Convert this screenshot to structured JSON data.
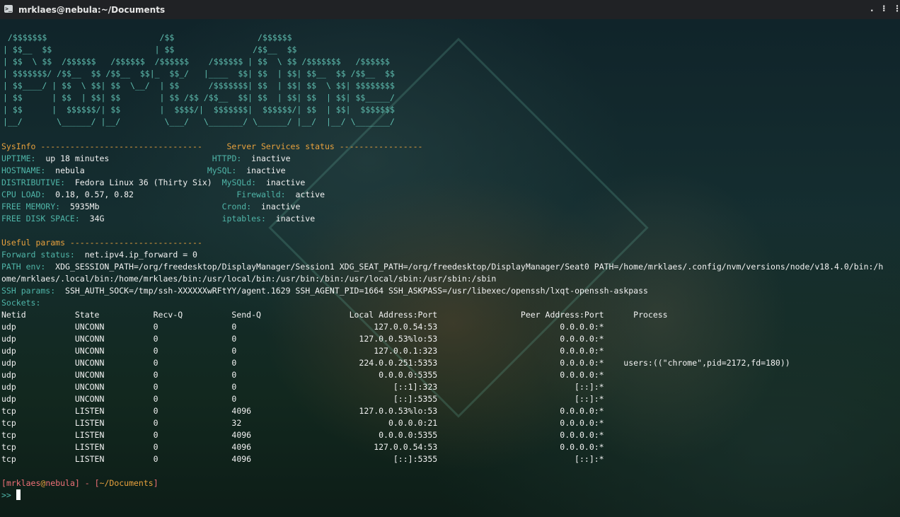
{
  "window": {
    "title": "mrklaes@nebula:~/Documents",
    "icon": "terminal-icon",
    "controls": [
      ".",
      "⁝",
      "⋮"
    ]
  },
  "banner": [
    " /$$$$$$$                       /$$                 /$$$$$$",
    "| $$__  $$                     | $$                /$$__  $$",
    "| $$  \\ $$  /$$$$$$   /$$$$$$  /$$$$$$    /$$$$$$ | $$  \\ $$ /$$$$$$$   /$$$$$$",
    "| $$$$$$$/ /$$__  $$ /$$__  $$|_  $$_/   |____  $$| $$  | $$| $$__  $$ /$$__  $$",
    "| $$____/ | $$  \\ $$| $$  \\__/  | $$      /$$$$$$$| $$  | $$| $$  \\ $$| $$$$$$$$",
    "| $$      | $$  | $$| $$        | $$ /$$ /$$__  $$| $$  | $$| $$  | $$| $$_____/",
    "| $$      |  $$$$$$/| $$        |  $$$$/|  $$$$$$$|  $$$$$$/| $$  | $$|  $$$$$$$",
    "|__/       \\______/ |__/         \\___/   \\_______/ \\______/ |__/  |__/ \\_______/"
  ],
  "sysinfo": {
    "header": "SysInfo ---------------------------------",
    "rows": [
      {
        "label": "UPTIME:",
        "value": "up 18 minutes"
      },
      {
        "label": "HOSTNAME:",
        "value": "nebula"
      },
      {
        "label": "DISTRIBUTIVE:",
        "value": "Fedora Linux 36 (Thirty Six)"
      },
      {
        "label": "CPU LOAD:",
        "value": "0.18, 0.57, 0.82"
      },
      {
        "label": "FREE MEMORY:",
        "value": "5935Mb"
      },
      {
        "label": "FREE DISK SPACE:",
        "value": "34G"
      }
    ]
  },
  "services": {
    "header": "Server Services status -----------------",
    "rows": [
      {
        "label": " HTTPD:",
        "value": "inactive"
      },
      {
        "label": "MySQL:",
        "value": "inactive"
      },
      {
        "label": "MySQLd:",
        "value": "inactive"
      },
      {
        "label": "Firewalld:",
        "value": "active"
      },
      {
        "label": "Crond:",
        "value": "inactive"
      },
      {
        "label": "iptables:",
        "value": "inactive"
      }
    ]
  },
  "params": {
    "header": "Useful params ---------------------------",
    "forward_label": "Forward status:",
    "forward_value": "net.ipv4.ip_forward = 0",
    "path_label": "PATH env:",
    "path_value": "XDG_SESSION_PATH=/org/freedesktop/DisplayManager/Session1 XDG_SEAT_PATH=/org/freedesktop/DisplayManager/Seat0 PATH=/home/mrklaes/.config/nvm/versions/node/v18.4.0/bin:/h",
    "path_value_cont": "ome/mrklaes/.local/bin:/home/mrklaes/bin:/usr/local/bin:/usr/bin:/bin:/usr/local/sbin:/usr/sbin:/sbin",
    "ssh_label": "SSH params:",
    "ssh_value": "SSH_AUTH_SOCK=/tmp/ssh-XXXXXXwRFtYY/agent.1629 SSH_AGENT_PID=1664 SSH_ASKPASS=/usr/libexec/openssh/lxqt-openssh-askpass"
  },
  "sockets": {
    "label": "Sockets:",
    "columns": [
      "Netid",
      "State",
      "Recv-Q",
      "Send-Q",
      "Local Address:Port",
      "Peer Address:Port",
      "Process"
    ],
    "rows": [
      [
        "udp",
        "UNCONN",
        "0",
        "0",
        "127.0.0.54:53",
        "0.0.0.0:*",
        ""
      ],
      [
        "udp",
        "UNCONN",
        "0",
        "0",
        "127.0.0.53%lo:53",
        "0.0.0.0:*",
        ""
      ],
      [
        "udp",
        "UNCONN",
        "0",
        "0",
        "127.0.0.1:323",
        "0.0.0.0:*",
        ""
      ],
      [
        "udp",
        "UNCONN",
        "0",
        "0",
        "224.0.0.251:5353",
        "0.0.0.0:*",
        "users:((\"chrome\",pid=2172,fd=180))"
      ],
      [
        "udp",
        "UNCONN",
        "0",
        "0",
        "0.0.0.0:5355",
        "0.0.0.0:*",
        ""
      ],
      [
        "udp",
        "UNCONN",
        "0",
        "0",
        "[::1]:323",
        "[::]:*",
        ""
      ],
      [
        "udp",
        "UNCONN",
        "0",
        "0",
        "[::]:5355",
        "[::]:*",
        ""
      ],
      [
        "tcp",
        "LISTEN",
        "0",
        "4096",
        "127.0.0.53%lo:53",
        "0.0.0.0:*",
        ""
      ],
      [
        "tcp",
        "LISTEN",
        "0",
        "32",
        "0.0.0.0:21",
        "0.0.0.0:*",
        ""
      ],
      [
        "tcp",
        "LISTEN",
        "0",
        "4096",
        "0.0.0.0:5355",
        "0.0.0.0:*",
        ""
      ],
      [
        "tcp",
        "LISTEN",
        "0",
        "4096",
        "127.0.0.54:53",
        "0.0.0.0:*",
        ""
      ],
      [
        "tcp",
        "LISTEN",
        "0",
        "4096",
        "[::]:5355",
        "[::]:*",
        ""
      ]
    ]
  },
  "prompt": {
    "open": "[",
    "user": "mrklaes",
    "at": "@",
    "host": "nebula",
    "close": "]",
    "sep": " - ",
    "dir_open": "[",
    "dir": "~/Documents",
    "dir_close": "]",
    "symbol": ">>"
  },
  "colors": {
    "label": "#4fb5a8",
    "header": "#e8a13d",
    "value": "#f2f2f2",
    "prompt": "#f07178"
  }
}
